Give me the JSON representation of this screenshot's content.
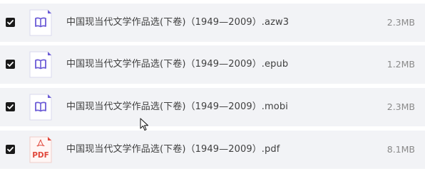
{
  "files": [
    {
      "name": "中国现当代文学作品选(下卷)（1949—2009）.azw3",
      "size": "2.3MB",
      "checked": true,
      "icon": "ebook-icon"
    },
    {
      "name": "中国现当代文学作品选(下卷)（1949—2009）.epub",
      "size": "1.2MB",
      "checked": true,
      "icon": "ebook-icon"
    },
    {
      "name": "中国现当代文学作品选(下卷)（1949—2009）.mobi",
      "size": "2.3MB",
      "checked": true,
      "icon": "ebook-icon"
    },
    {
      "name": "中国现当代文学作品选(下卷)（1949—2009）.pdf",
      "size": "8.1MB",
      "checked": true,
      "icon": "pdf-icon",
      "icon_label": "PDF"
    }
  ],
  "colors": {
    "row_background": "#f2f3f6",
    "checkbox": "#1a1a1a",
    "ebook_accent": "#6b5bd6",
    "pdf_accent": "#e0473b",
    "name_text": "#404040",
    "size_text": "#8a8a8a"
  }
}
